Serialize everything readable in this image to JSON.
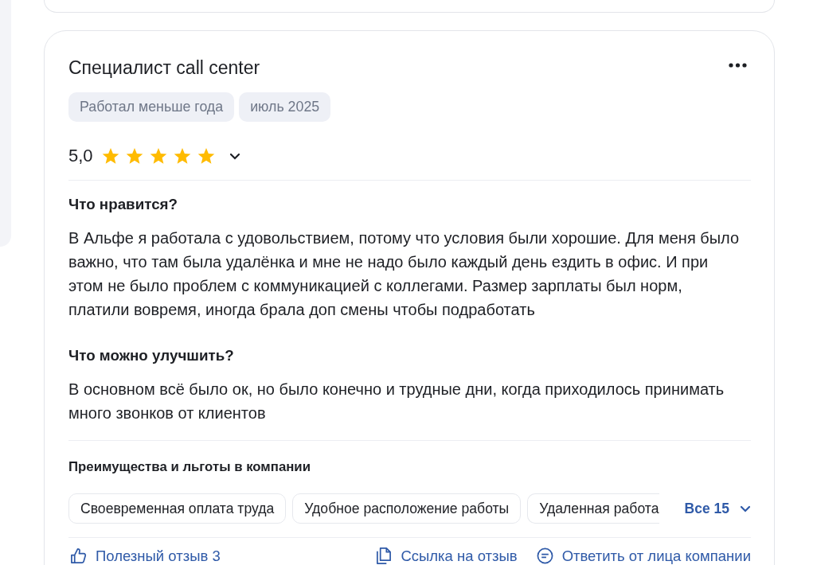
{
  "review": {
    "title": "Специалист call center",
    "tags": [
      "Работал меньше года",
      "июль 2025"
    ],
    "rating": {
      "value": "5,0",
      "stars": 5
    },
    "sections": [
      {
        "heading": "Что нравится?",
        "text": "В Альфе я работала с удовольствием, потому что условия были хорошие. Для меня было важно, что там была удалёнка и мне не надо было каждый день ездить в офис. И при этом не было проблем с коммуникацией с коллегами. Размер зарплаты был норм, платили вовремя, иногда брала доп смены чтобы подработать"
      },
      {
        "heading": "Что можно улучшить?",
        "text": "В основном всё было ок, но было конечно и трудные дни, когда приходилось принимать много звонков от клиентов"
      }
    ],
    "benefits": {
      "title": "Преимущества и льготы в компании",
      "items": [
        "Своевременная оплата труда",
        "Удобное расположение работы",
        "Удаленная работа"
      ],
      "more_button": "Все 15"
    },
    "actions": [
      {
        "kind": "like",
        "label": "Полезный отзыв 3"
      },
      {
        "kind": "link",
        "label": "Ссылка на отзыв"
      },
      {
        "kind": "reply",
        "label": "Ответить от лица компании"
      }
    ]
  }
}
